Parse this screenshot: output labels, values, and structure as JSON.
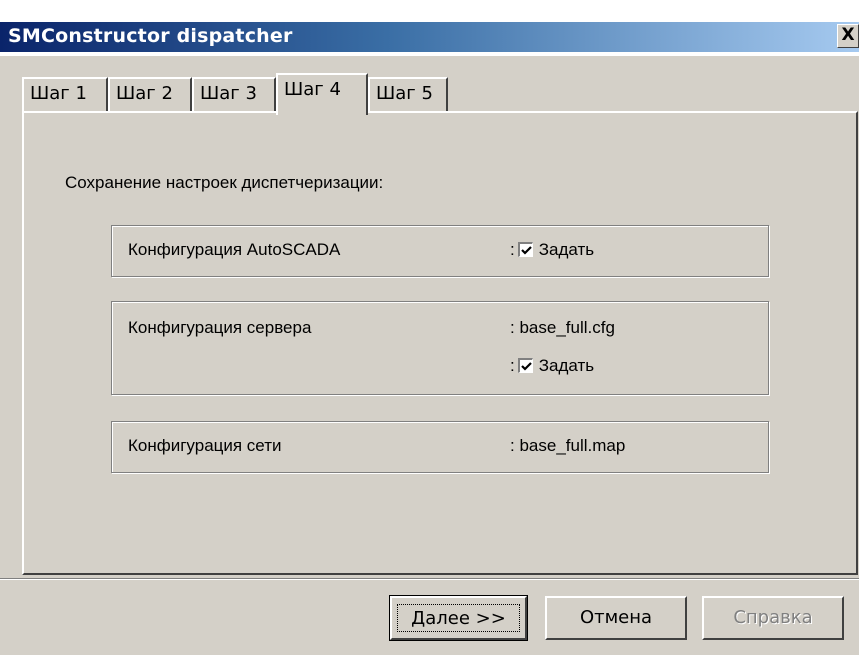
{
  "window": {
    "title": "SMConstructor dispatcher",
    "close_label": "X"
  },
  "tabs": [
    {
      "label": "Шаг 1",
      "active": false
    },
    {
      "label": "Шаг 2",
      "active": false
    },
    {
      "label": "Шаг 3",
      "active": false
    },
    {
      "label": "Шаг 4",
      "active": true
    },
    {
      "label": "Шаг 5",
      "active": false
    }
  ],
  "section": {
    "title": "Сохранение настроек диспетчеризации:"
  },
  "groups": {
    "autoscada": {
      "label": "Конфигурация AutoSCADA",
      "checkbox_label": "Задать",
      "checked": true
    },
    "server": {
      "label": "Конфигурация сервера",
      "file": "base_full.cfg",
      "checkbox_label": "Задать",
      "checked": true
    },
    "network": {
      "label": "Конфигурация сети",
      "file": "base_full.map"
    }
  },
  "buttons": {
    "next": "Далее >>",
    "cancel": "Отмена",
    "help": "Справка"
  }
}
